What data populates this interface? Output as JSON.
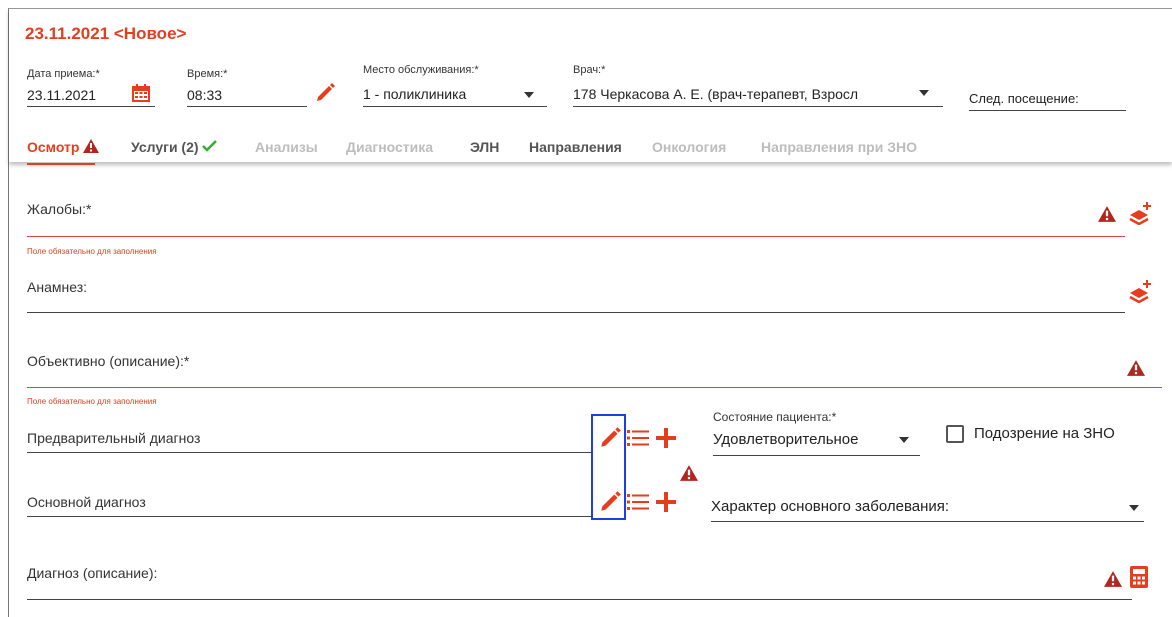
{
  "header": {
    "title": "23.11.2021 <Новое>",
    "date_label": "Дата приема:*",
    "date_value": "23.11.2021",
    "time_label": "Время:*",
    "time_value": "08:33",
    "place_label": "Место обслуживания:*",
    "place_value": "1 - поликлиника",
    "doctor_label": "Врач:*",
    "doctor_value": "178 Черкасова А. Е. (врач-терапевт, Взросл",
    "next_visit_label": "След. посещение:"
  },
  "tabs": [
    {
      "label": "Осмотр"
    },
    {
      "label": "Услуги (2)"
    },
    {
      "label": "Анализы"
    },
    {
      "label": "Диагностика"
    },
    {
      "label": "ЭЛН"
    },
    {
      "label": "Направления"
    },
    {
      "label": "Онкология"
    },
    {
      "label": "Направления при ЗНО"
    }
  ],
  "form": {
    "complaints_label": "Жалобы:*",
    "required_msg": "Поле обязательно для заполнения",
    "anamnesis_label": "Анамнез:",
    "objective_label": "Объективно (описание):*",
    "required_msg2": "Поле обязательно для заполнения",
    "prelim_diag_label": "Предварительный диагноз",
    "main_diag_label": "Основной диагноз",
    "patient_state_label": "Состояние пациента:*",
    "patient_state_value": "Удовлетворительное",
    "zno_label": "Подозрение на ЗНО",
    "disease_char_label": "Характер основного заболевания:",
    "diag_desc_label": "Диагноз (описание):"
  },
  "colors": {
    "accent": "#e53d1e",
    "highlight": "#1f3fe6",
    "check": "#3aa935"
  }
}
